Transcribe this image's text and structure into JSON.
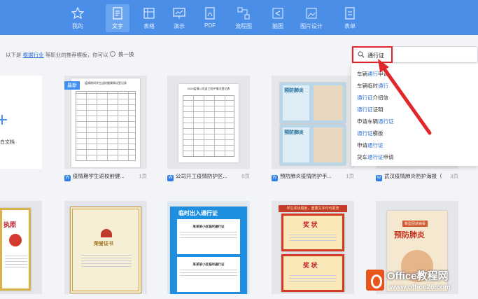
{
  "tabs": [
    {
      "label": "我的",
      "icon": "star-icon"
    },
    {
      "label": "文字",
      "icon": "document-icon",
      "active": true
    },
    {
      "label": "表格",
      "icon": "table-icon"
    },
    {
      "label": "演示",
      "icon": "presentation-icon"
    },
    {
      "label": "PDF",
      "icon": "pdf-icon"
    },
    {
      "label": "流程图",
      "icon": "flowchart-icon"
    },
    {
      "label": "脑图",
      "icon": "mindmap-icon"
    },
    {
      "label": "图片设计",
      "icon": "image-design-icon"
    },
    {
      "label": "表单",
      "icon": "form-icon"
    }
  ],
  "subheader": {
    "prefix": "以下是",
    "industry_link": "根据行业",
    "suffix": "等职业的推荐模板，你可以",
    "refresh_label": "换一换"
  },
  "search": {
    "value": "通行证",
    "suggestions": [
      {
        "pre": "车辆",
        "kw": "通行",
        "post": "申请"
      },
      {
        "pre": "车辆临时",
        "kw": "通行",
        "post": ""
      },
      {
        "pre": "",
        "kw": "通行证",
        "post": "介绍信"
      },
      {
        "pre": "",
        "kw": "通行证",
        "post": "证明"
      },
      {
        "pre": "申请车辆",
        "kw": "通行证",
        "post": ""
      },
      {
        "pre": "",
        "kw": "通行证",
        "post": "模板"
      },
      {
        "pre": "申请",
        "kw": "通行证",
        "post": ""
      },
      {
        "pre": "货车",
        "kw": "通行证",
        "post": "申请"
      }
    ]
  },
  "cards_row1": [
    {
      "title": "白文档",
      "pages": ""
    },
    {
      "title": "疫情期学生返校前健...",
      "pages": "1页",
      "badge": "最新"
    },
    {
      "title": "公司开工疫情防护区...",
      "pages": "0页"
    },
    {
      "title": "预防肺炎疫情防护手...",
      "pages": "1页"
    },
    {
      "title": "",
      "pages": ""
    },
    {
      "title": "武汉疫情肺炎防护海报（",
      "pages": "3页"
    }
  ],
  "cards_row2": [
    {
      "thumb_text": "执照"
    },
    {
      "thumb_text": "荣誉证书"
    },
    {
      "thumb_text": "临时出入通行证"
    },
    {
      "thumb_text": "奖 状"
    },
    {
      "thumb_text": "奖 状"
    },
    {
      "thumb_text": "预防肺炎"
    }
  ],
  "thumbs": {
    "card2_head": "疫情期间学生返校健康情况登记表",
    "card3_head": "2020疫情公司返工防护情况登记表",
    "poster_head": "预防肺炎",
    "blank_label": "白文档",
    "pass_sub": "某某某小区临时通行证",
    "award_top": "学生奖状模板，重要文字均可更改",
    "poster_sub": "新型冠状病毒"
  },
  "watermark": {
    "brand": "Office教程网",
    "url": "www.office26.com"
  },
  "colors": {
    "accent": "#4a8ee8",
    "highlight": "#e0282a",
    "link": "#2a6fd6"
  }
}
